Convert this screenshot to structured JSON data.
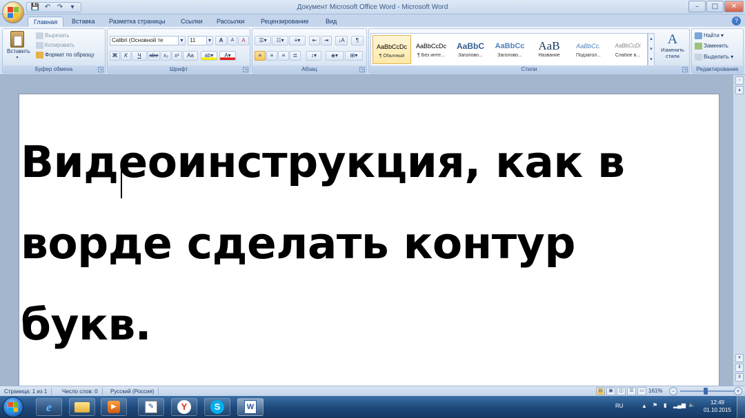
{
  "window": {
    "title": "Документ Microsoft Office Word - Microsoft Word",
    "controls": [
      "–",
      "□",
      "✕"
    ]
  },
  "quick_access": {
    "save": "💾",
    "undo": "↶",
    "redo": "↷",
    "more": "▾"
  },
  "tabs": [
    "Главная",
    "Вставка",
    "Разметка страницы",
    "Ссылки",
    "Рассылки",
    "Рецензирование",
    "Вид"
  ],
  "active_tab": "Главная",
  "ribbon": {
    "clipboard": {
      "group_name": "Буфер обмена",
      "paste": "Вставить",
      "cut": "Вырезать",
      "copy": "Копировать",
      "format_painter": "Формат по образцу"
    },
    "font": {
      "group_name": "Шрифт",
      "font_name": "Calibri (Основной те",
      "font_size": "11",
      "bold": "Ж",
      "italic": "К",
      "underline": "Ч",
      "strike": "abe",
      "subscript": "x₂",
      "superscript": "x²",
      "change_case": "Aa",
      "grow": "A",
      "shrink": "A",
      "clear": "A"
    },
    "paragraph": {
      "group_name": "Абзац"
    },
    "styles": {
      "group_name": "Стили",
      "items": [
        {
          "preview": "AaBbCcDc",
          "name": "¶ Обычный"
        },
        {
          "preview": "AaBbCcDc",
          "name": "¶ Без инте..."
        },
        {
          "preview": "AaBbC",
          "name": "Заголово..."
        },
        {
          "preview": "AaBbCc",
          "name": "Заголово..."
        },
        {
          "preview": "AaB",
          "name": "Название"
        },
        {
          "preview": "AaBbCc.",
          "name": "Подзагол..."
        },
        {
          "preview": "AaBbCcDi",
          "name": "Слабое в..."
        }
      ],
      "change_styles": "Изменить стили"
    },
    "editing": {
      "group_name": "Редактирование",
      "find": "Найти",
      "replace": "Заменить",
      "select": "Выделить"
    }
  },
  "document": {
    "lines": [
      "Видеоинструкция, как в",
      "ворде сделать контур",
      "букв."
    ]
  },
  "status": {
    "page": "Страница: 1 из 1",
    "words": "Число слов: 0",
    "language": "Русский (Россия)",
    "zoom": "161%"
  },
  "taskbar": {
    "lang": "RU",
    "time": "12:49",
    "date": "01.10.2015",
    "apps": [
      "explorer",
      "ie",
      "folder",
      "media",
      "paint",
      "yandex",
      "skype",
      "word"
    ]
  },
  "colors": {
    "ribbon_text": "#15428b",
    "selected": "#f5c65a",
    "taskbar": "#1f4a7c"
  }
}
